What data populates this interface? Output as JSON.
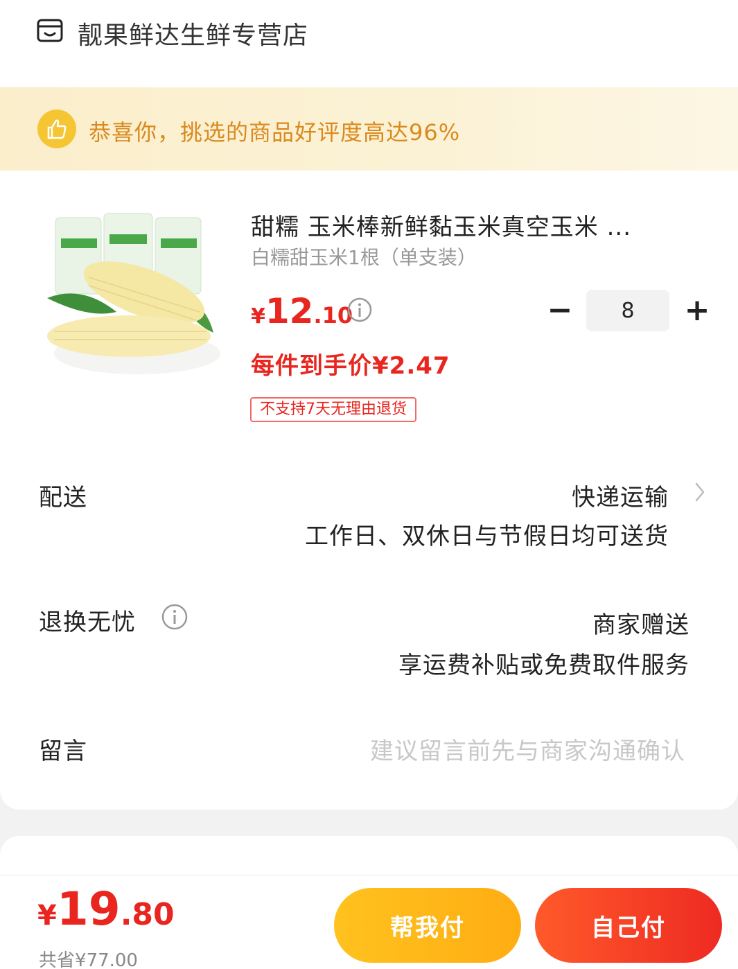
{
  "store": {
    "name": "靓果鲜达生鲜专营店",
    "icon": "store-icon"
  },
  "banner": {
    "text": "恭喜你，挑选的商品好评度高达96%",
    "icon": "thumbs-up-icon"
  },
  "product": {
    "title": "甜糯 玉米棒新鲜黏玉米真空玉米 ...",
    "spec": "白糯甜玉米1根（单支装）",
    "price_symbol": "¥",
    "price_int": "12",
    "price_dec": ".10",
    "quantity": "8",
    "unit_price": "每件到手价¥2.47",
    "return_tag": "不支持7天无理由退货"
  },
  "delivery": {
    "label": "配送",
    "method": "快递运输",
    "note": "工作日、双休日与节假日均可送货"
  },
  "returns": {
    "label": "退换无忧",
    "value": "商家赠送",
    "note": "享运费补贴或免费取件服务"
  },
  "remark": {
    "label": "留言",
    "placeholder": "建议留言前先与商家沟通确认"
  },
  "footer": {
    "price_symbol": "¥",
    "total_int": "19",
    "total_dec": ".80",
    "saved": "共省¥77.00",
    "help_pay_label": "帮我付",
    "self_pay_label": "自己付"
  },
  "colors": {
    "accent_red": "#e8261f",
    "banner_text": "#d98a1e",
    "help_btn": "#ffb81a",
    "pay_btn": "#f0352a"
  }
}
